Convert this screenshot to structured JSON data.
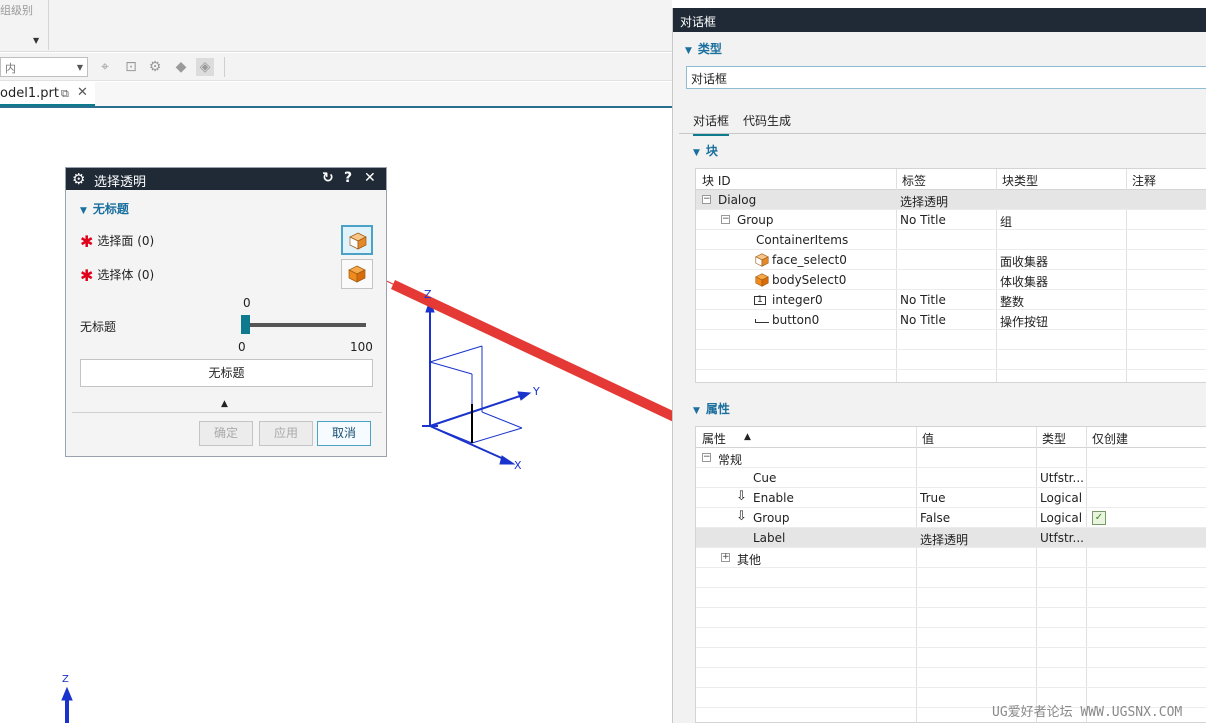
{
  "ribbon": {
    "group_label": "组级别"
  },
  "toolbar": {
    "filter_value": "内"
  },
  "doc_tab": {
    "label": "odel1.prt"
  },
  "axes": {
    "z": "Z",
    "y": "Y",
    "x": "X",
    "z2": "Z"
  },
  "dialog": {
    "title": "选择透明",
    "section": "无标题",
    "select_face": "选择面 (0)",
    "select_body": "选择体 (0)",
    "slider_value": "0",
    "slider_label": "无标题",
    "slider_min": "0",
    "slider_max": "100",
    "slider_fraction": 0,
    "button_label": "无标题",
    "ok": "确定",
    "apply": "应用",
    "cancel": "取消"
  },
  "panel": {
    "title": "对话框",
    "type_section": "类型",
    "type_value": "对话框",
    "tabs": [
      "对话框",
      "代码生成"
    ],
    "block_section": "块",
    "block_headers": [
      "块 ID",
      "标签",
      "块类型",
      "注释"
    ],
    "block_rows": [
      {
        "id": "Dialog",
        "label": "选择透明",
        "type": ""
      },
      {
        "id": "Group",
        "label": "No Title",
        "type": "组"
      },
      {
        "id": "ContainerItems",
        "label": "",
        "type": ""
      },
      {
        "id": "face_select0",
        "label": "",
        "type": "面收集器"
      },
      {
        "id": "bodySelect0",
        "label": "",
        "type": "体收集器"
      },
      {
        "id": "integer0",
        "label": "No Title",
        "type": "整数"
      },
      {
        "id": "button0",
        "label": "No Title",
        "type": "操作按钮"
      }
    ],
    "prop_section": "属性",
    "prop_headers": [
      "属性",
      "值",
      "类型",
      "仅创建"
    ],
    "prop_rows": [
      {
        "name": "常规",
        "value": "",
        "type": ""
      },
      {
        "name": "Cue",
        "value": "",
        "type": "Utfstr..."
      },
      {
        "name": "Enable",
        "value": "True",
        "type": "Logical"
      },
      {
        "name": "Group",
        "value": "False",
        "type": "Logical"
      },
      {
        "name": "Label",
        "value": "选择透明",
        "type": "Utfstr..."
      },
      {
        "name": "其他",
        "value": "",
        "type": ""
      }
    ]
  },
  "watermark": "UG爱好者论坛 WWW.UGSNX.COM",
  "colors": {
    "accent": "#0d7a8e",
    "title_bar": "#1f2a36",
    "arrow": "#e53935",
    "axis": "#1a33cc",
    "required": "#e0001b"
  }
}
